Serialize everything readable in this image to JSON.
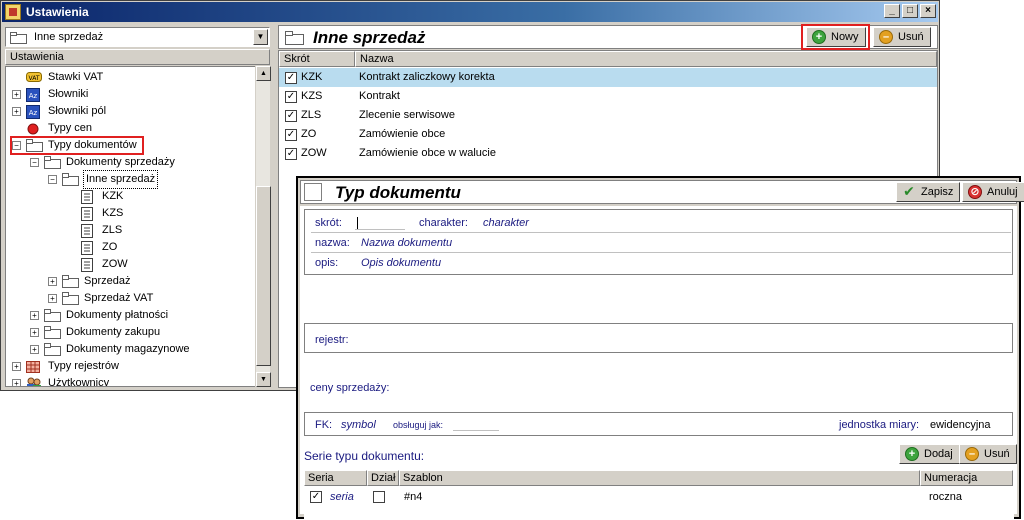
{
  "window": {
    "title": "Ustawienia",
    "buttons": [
      "_",
      "□",
      "×"
    ]
  },
  "left": {
    "combo_value": "Inne sprzedaż",
    "header": "Ustawienia",
    "tree": [
      {
        "label": "Stawki VAT",
        "icon": "vat-icon"
      },
      {
        "label": "Słowniki",
        "icon": "dictionary-icon"
      },
      {
        "label": "Słowniki pól",
        "icon": "dictionary-icon"
      },
      {
        "label": "Typy cen",
        "icon": "red-dot-icon"
      },
      {
        "label": "Typy dokumentów",
        "icon": "folder-icon"
      },
      {
        "label": "Dokumenty sprzedaży",
        "icon": "folder-icon"
      },
      {
        "label": "Inne sprzedaż",
        "icon": "folder-icon"
      },
      {
        "label": "KZK",
        "icon": "document-icon"
      },
      {
        "label": "KZS",
        "icon": "document-icon"
      },
      {
        "label": "ZLS",
        "icon": "document-icon"
      },
      {
        "label": "ZO",
        "icon": "document-icon"
      },
      {
        "label": "ZOW",
        "icon": "document-icon"
      },
      {
        "label": "Sprzedaż",
        "icon": "folder-icon"
      },
      {
        "label": "Sprzedaż VAT",
        "icon": "folder-icon"
      },
      {
        "label": "Dokumenty płatności",
        "icon": "folder-icon"
      },
      {
        "label": "Dokumenty zakupu",
        "icon": "folder-icon"
      },
      {
        "label": "Dokumenty magazynowe",
        "icon": "folder-icon"
      },
      {
        "label": "Typy rejestrów",
        "icon": "grid-icon"
      },
      {
        "label": "Użytkownicy",
        "icon": "users-icon"
      }
    ]
  },
  "right": {
    "title": "Inne sprzedaż",
    "new_label": "Nowy",
    "delete_label": "Usuń",
    "columns": [
      "Skrót",
      "Nazwa"
    ],
    "rows": [
      {
        "code": "KZK",
        "name": "Kontrakt zaliczkowy korekta",
        "checked": true
      },
      {
        "code": "KZS",
        "name": "Kontrakt",
        "checked": true
      },
      {
        "code": "ZLS",
        "name": "Zlecenie serwisowe",
        "checked": true
      },
      {
        "code": "ZO",
        "name": "Zamówienie obce",
        "checked": true
      },
      {
        "code": "ZOW",
        "name": "Zamówienie obce w walucie",
        "checked": true
      }
    ]
  },
  "dialog": {
    "title": "Typ dokumentu",
    "save_label": "Zapisz",
    "cancel_label": "Anuluj",
    "fields": {
      "skrot_label": "skrót:",
      "charakter_label": "charakter:",
      "charakter_value": "charakter",
      "nazwa_label": "nazwa:",
      "nazwa_value": "Nazwa dokumentu",
      "opis_label": "opis:",
      "opis_value": "Opis dokumentu",
      "rejestr_label": "rejestr:",
      "ceny_label": "ceny sprzedaży:",
      "fk_label": "FK:",
      "fk_value": "symbol",
      "obsluguj_label": "obsługuj jak:",
      "jednostka_label": "jednostka miary:",
      "jednostka_value": "ewidencyjna"
    },
    "series": {
      "title": "Serie typu dokumentu:",
      "add_label": "Dodaj",
      "delete_label": "Usuń",
      "columns": [
        "Seria",
        "Dział",
        "Szablon",
        "Numeracja"
      ],
      "rows": [
        {
          "seria": "seria",
          "dzial_checked": false,
          "szablon": "#n4",
          "numeracja": "roczna",
          "checked": true
        }
      ]
    }
  }
}
